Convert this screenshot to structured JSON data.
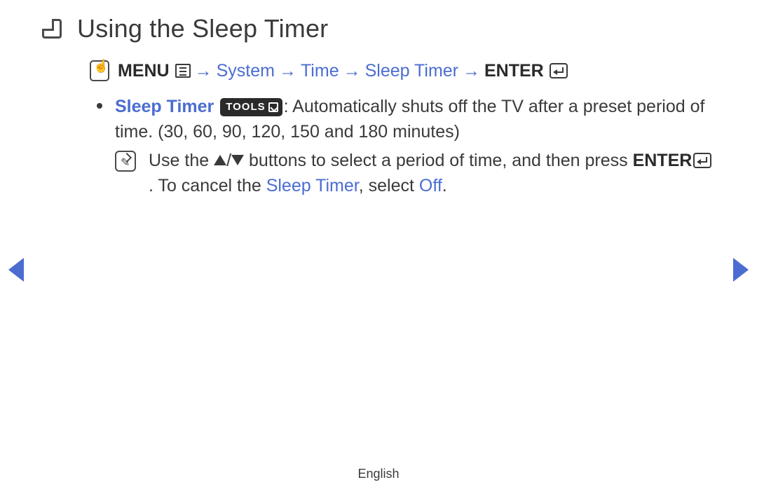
{
  "title": "Using the Sleep Timer",
  "nav": {
    "menu": "MENU",
    "step1": "System",
    "step2": "Time",
    "step3": "Sleep Timer",
    "enter": "ENTER",
    "arrow": "→"
  },
  "bullet": {
    "label": "Sleep Timer",
    "tools": "TOOLS",
    "desc1": ": Automatically shuts off the TV after a preset period of time. (30, 60, 90, 120, 150 and 180 minutes)"
  },
  "note": {
    "part1": "Use the ",
    "part2": " buttons to select a period of time, and then press ",
    "enter": "ENTER",
    "part3": ". To cancel the ",
    "sleep": "Sleep Timer",
    "part4": ", select ",
    "off": "Off",
    "part5": "."
  },
  "slash": "/",
  "footer": "English"
}
